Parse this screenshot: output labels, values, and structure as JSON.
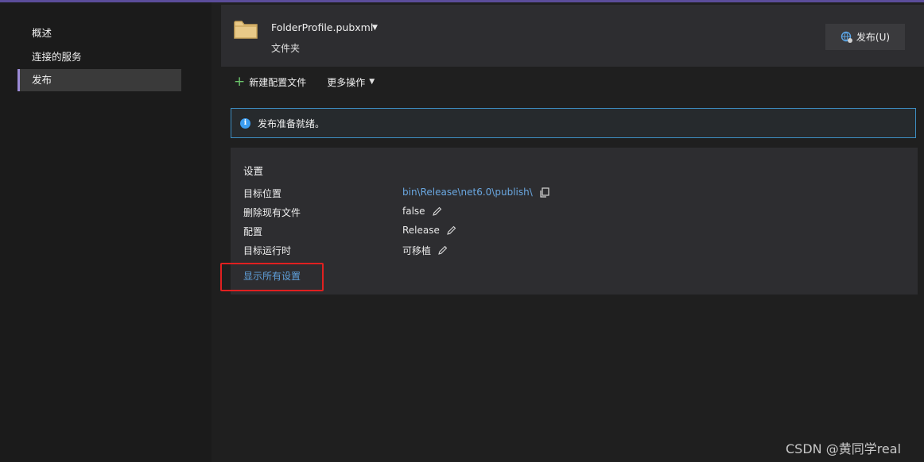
{
  "sidebar": {
    "items": [
      {
        "label": "概述"
      },
      {
        "label": "连接的服务"
      },
      {
        "label": "发布"
      }
    ]
  },
  "header": {
    "profile_name": "FolderProfile.pubxml",
    "profile_type": "文件夹",
    "publish_label": "发布(U)"
  },
  "toolbar": {
    "new_profile_label": "新建配置文件",
    "more_actions_label": "更多操作"
  },
  "info": {
    "message": "发布准备就绪。"
  },
  "settings": {
    "title": "设置",
    "rows": [
      {
        "label": "目标位置",
        "value": "bin\\Release\\net6.0\\publish\\"
      },
      {
        "label": "删除现有文件",
        "value": "false"
      },
      {
        "label": "配置",
        "value": "Release"
      },
      {
        "label": "目标运行时",
        "value": "可移植"
      }
    ],
    "show_all_label": "显示所有设置"
  },
  "watermark": "CSDN @黄同学real",
  "colors": {
    "accent": "#9b8bd6",
    "link": "#6aa7e0",
    "info_border": "#3d8ec2",
    "highlight": "#e02020"
  }
}
